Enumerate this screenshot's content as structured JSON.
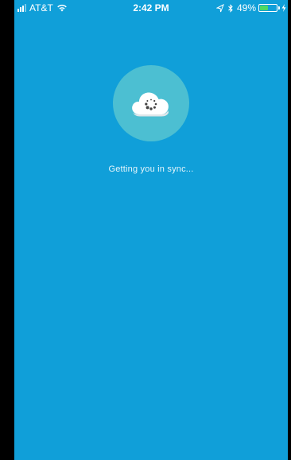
{
  "status_bar": {
    "carrier": "AT&T",
    "time": "2:42 PM",
    "battery_percent": "49%",
    "battery_level": 0.49,
    "signal_bars_filled": 3,
    "icons": [
      "signal-icon",
      "wifi-icon",
      "location-arrow-icon",
      "bluetooth-icon",
      "battery-icon",
      "charging-bolt-icon"
    ]
  },
  "main": {
    "sync_icon": "cloud-sync-icon",
    "message": "Getting you in sync..."
  },
  "colors": {
    "background": "#109fd9",
    "badge_circle": "#4cbfd2",
    "cloud": "#ffffff",
    "spinner_dots": "#444444",
    "battery_fill": "#4cd964"
  }
}
